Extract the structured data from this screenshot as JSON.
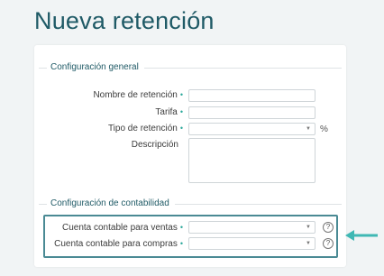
{
  "page": {
    "title": "Nueva retención"
  },
  "general": {
    "legend": "Configuración general",
    "fields": {
      "nombre": {
        "label": "Nombre de retención",
        "value": ""
      },
      "tarifa": {
        "label": "Tarifa",
        "value": ""
      },
      "tipo": {
        "label": "Tipo de retención",
        "value": "",
        "suffix": "%"
      },
      "descripcion": {
        "label": "Descripción",
        "value": ""
      }
    }
  },
  "contabilidad": {
    "legend": "Configuración de contabilidad",
    "fields": {
      "ventas": {
        "label": "Cuenta contable para ventas",
        "value": ""
      },
      "compras": {
        "label": "Cuenta contable para compras",
        "value": ""
      }
    }
  },
  "required_marker": "•",
  "help_glyph": "?",
  "colors": {
    "title": "#1f5a66",
    "required": "#2aa89a",
    "highlight": "#4a8a94",
    "arrow": "#3fb8b4"
  },
  "icons": {
    "dropdown": "chevron-down-icon",
    "help": "question-circle-icon",
    "pointer": "arrow-left-icon"
  }
}
